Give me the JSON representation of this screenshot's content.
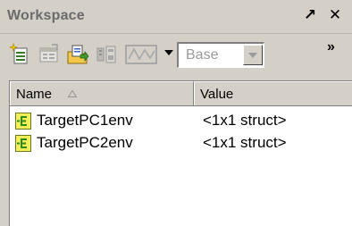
{
  "window": {
    "title": "Workspace",
    "undock_glyph": "↗",
    "close_glyph": "✕"
  },
  "toolbar": {
    "icons": [
      "new-variable-icon",
      "open-selection-icon",
      "import-data-icon",
      "save-workspace-icon",
      "plot-icon",
      "plot-dropdown-icon"
    ],
    "stack_select": {
      "value": "Base",
      "enabled": false
    },
    "overflow_glyph": "»"
  },
  "table": {
    "columns": [
      {
        "label": "Name",
        "sorted": "ascending"
      },
      {
        "label": "Value"
      }
    ],
    "rows": [
      {
        "name": "TargetPC1env",
        "value": "<1x1 struct>",
        "icon": "struct-icon"
      },
      {
        "name": "TargetPC2env",
        "value": "<1x1 struct>",
        "icon": "struct-icon"
      }
    ]
  },
  "colors": {
    "title_text": "#6b6b6b",
    "panel_bg": "#d4d0c8",
    "struct_icon_fill": "#f4ee5a",
    "struct_icon_mark": "#2d8a18",
    "disabled_text": "#9a9a9a"
  }
}
